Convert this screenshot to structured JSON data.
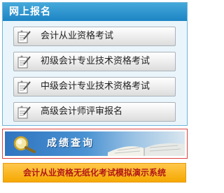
{
  "panel": {
    "title": "网上报名"
  },
  "items": [
    {
      "label": "会计从业资格考试"
    },
    {
      "label": "初级会计专业技术资格考试"
    },
    {
      "label": "中级会计专业技术资格考试"
    },
    {
      "label": "高级会计师评审报名"
    }
  ],
  "score_query": {
    "label": "成绩查询"
  },
  "simulation": {
    "label": "会计从业资格无纸化考试模拟演示系统"
  },
  "colors": {
    "header": "#1d84c4",
    "panel_border": "#6fb4da",
    "highlight_border": "#e04040",
    "sim_bar": "#f5a800",
    "sim_text": "#b21717"
  }
}
